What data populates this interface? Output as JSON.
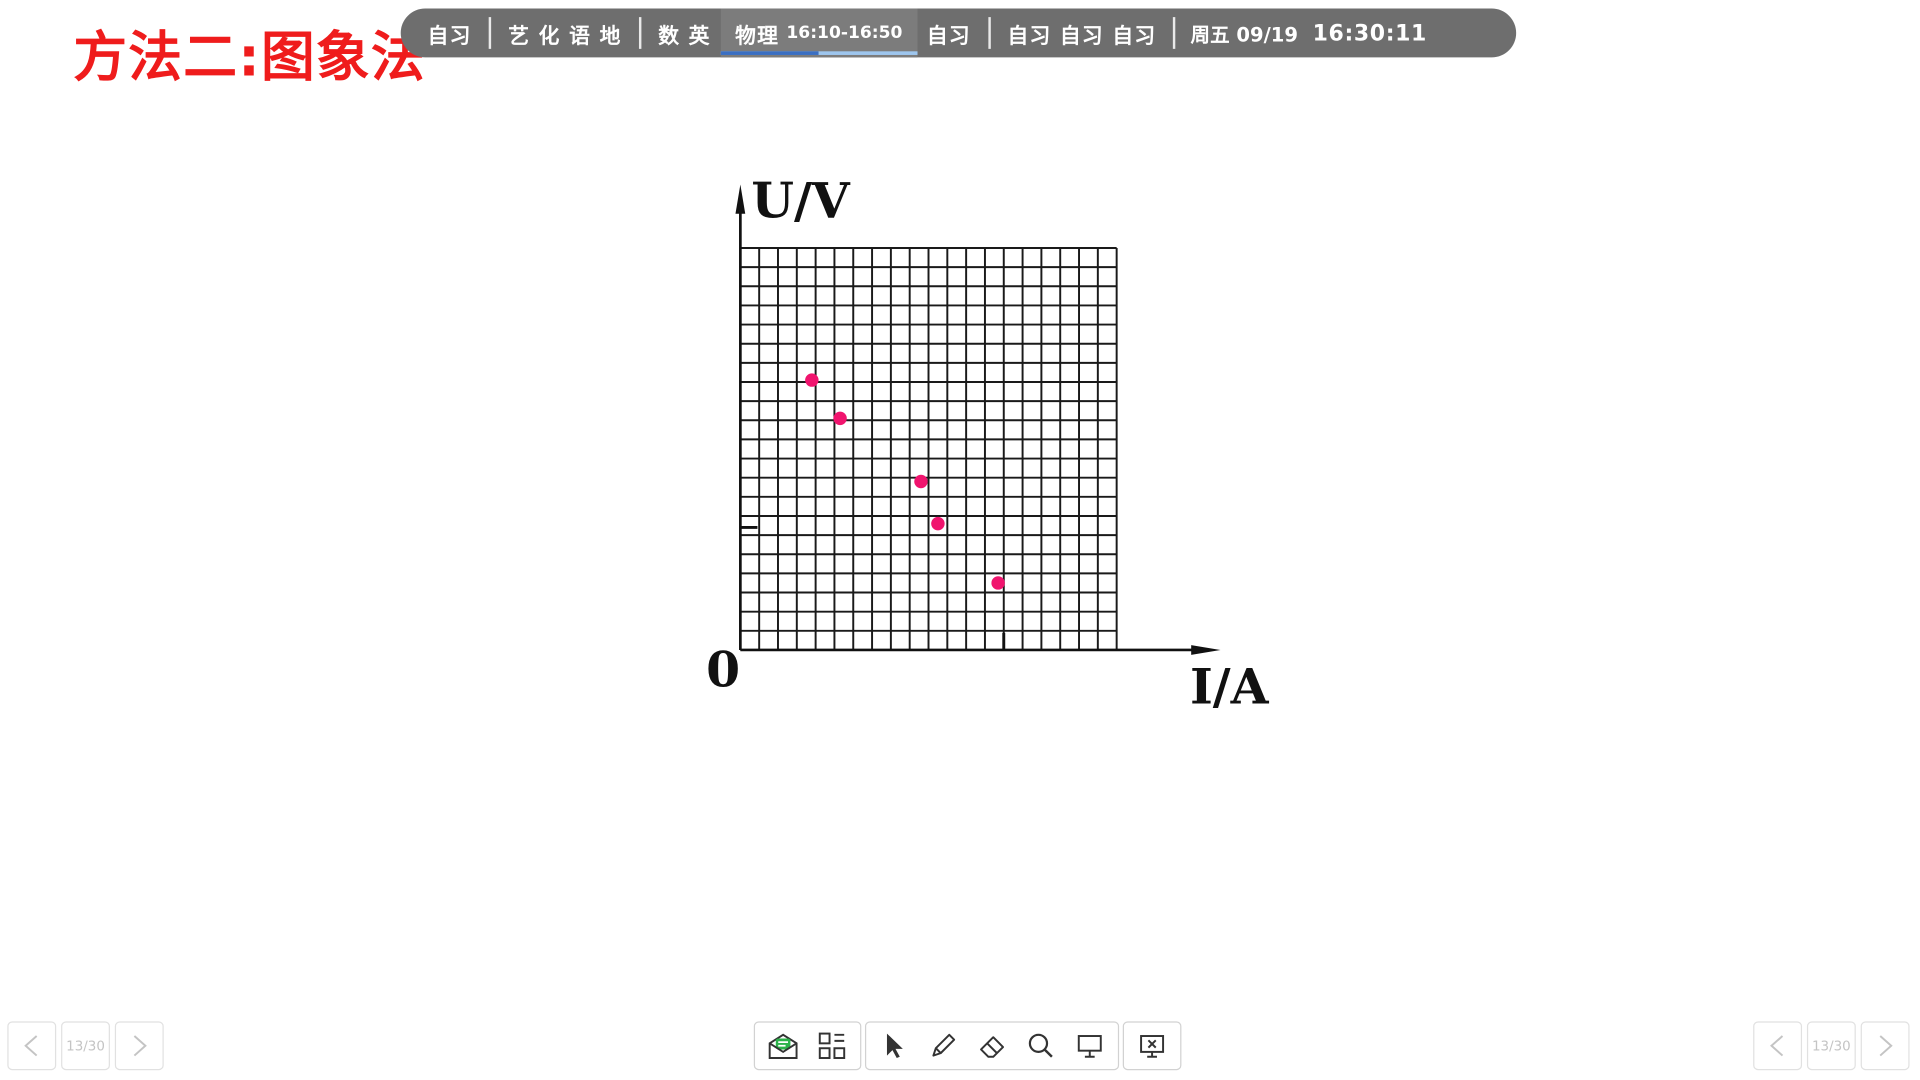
{
  "slide": {
    "title": "方法二:图象法"
  },
  "schedule": {
    "items": [
      {
        "label": "自习"
      },
      {
        "label": "艺 化 语 地"
      },
      {
        "label": "数 英"
      },
      {
        "label": "物理",
        "time": "16:10-16:50",
        "current": true,
        "progress": 0.5
      },
      {
        "label": "自习"
      },
      {
        "label": "自习 自习 自习"
      }
    ],
    "weekday_date": "周五 09/19",
    "clock": "16:30:11"
  },
  "chart_data": {
    "type": "scatter",
    "xlabel": "I/A",
    "ylabel": "U/V",
    "origin_label": "0",
    "grid": "on",
    "grid_divisions": {
      "x": 20,
      "y": 21
    },
    "xlim": [
      0,
      20
    ],
    "ylim": [
      0,
      21
    ],
    "points": [
      {
        "x": 3.8,
        "y": 14.1
      },
      {
        "x": 5.3,
        "y": 12.1
      },
      {
        "x": 9.6,
        "y": 8.8
      },
      {
        "x": 10.5,
        "y": 6.6
      },
      {
        "x": 13.7,
        "y": 3.5
      }
    ],
    "point_color": "#f0146e",
    "marked_ticks": {
      "x": 14,
      "y": 6.4
    }
  },
  "page_nav": {
    "page_indicator": "13/30"
  },
  "toolbar": {
    "tools": [
      {
        "name": "mailbox-icon"
      },
      {
        "name": "apps-grid-icon"
      },
      {
        "name": "pointer-icon"
      },
      {
        "name": "pen-icon"
      },
      {
        "name": "eraser-icon"
      },
      {
        "name": "magnifier-icon"
      },
      {
        "name": "presentation-icon"
      },
      {
        "name": "close-slideshow-icon"
      }
    ]
  }
}
